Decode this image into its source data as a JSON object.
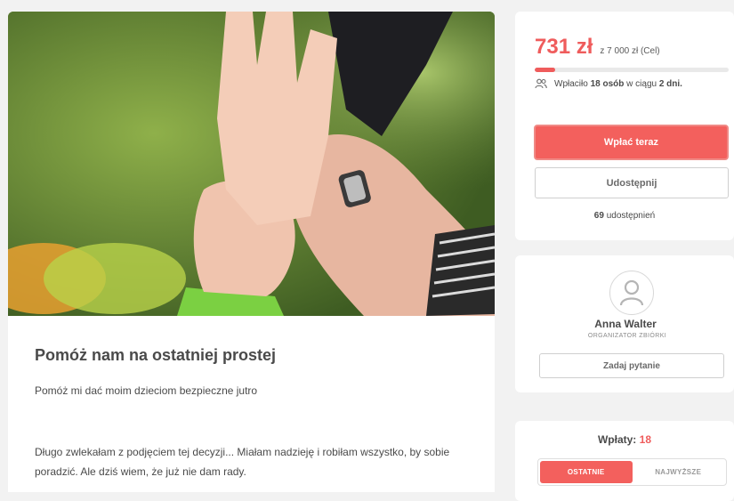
{
  "campaign": {
    "title": "Pomóż nam na ostatniej prostej",
    "subtitle": "Pomóż mi dać moim dzieciom bezpieczne jutro",
    "description": "Długo zwlekałam z podjęciem tej decyzji... Miałam nadzieję i robiłam wszystko, by sobie poradzić. Ale dziś wiem, że już nie dam rady."
  },
  "funding": {
    "raised": "731 zł",
    "goal_text": "z 7 000 zł (Cel)",
    "progress_percent": 10.4,
    "donors_prefix": "Wpłaciło",
    "donors_count": "18 osób",
    "donors_middle": "w ciągu",
    "donors_days": "2 dni.",
    "donate_label": "Wpłać teraz",
    "share_label": "Udostępnij",
    "shares_count": "69",
    "shares_suffix": "udostępnień"
  },
  "organizer": {
    "name": "Anna Walter",
    "role": "ORGANIZATOR ZBIÓRKI",
    "ask_label": "Zadaj pytanie"
  },
  "payments": {
    "label": "Wpłaty:",
    "count": "18",
    "tabs": [
      {
        "label": "OSTATNIE",
        "active": true
      },
      {
        "label": "NAJWYŻSZE",
        "active": false
      }
    ]
  },
  "colors": {
    "accent": "#ef5c5c",
    "background": "#f2f2f2"
  },
  "icons": {
    "donors": "people-icon",
    "avatar": "user-icon"
  }
}
